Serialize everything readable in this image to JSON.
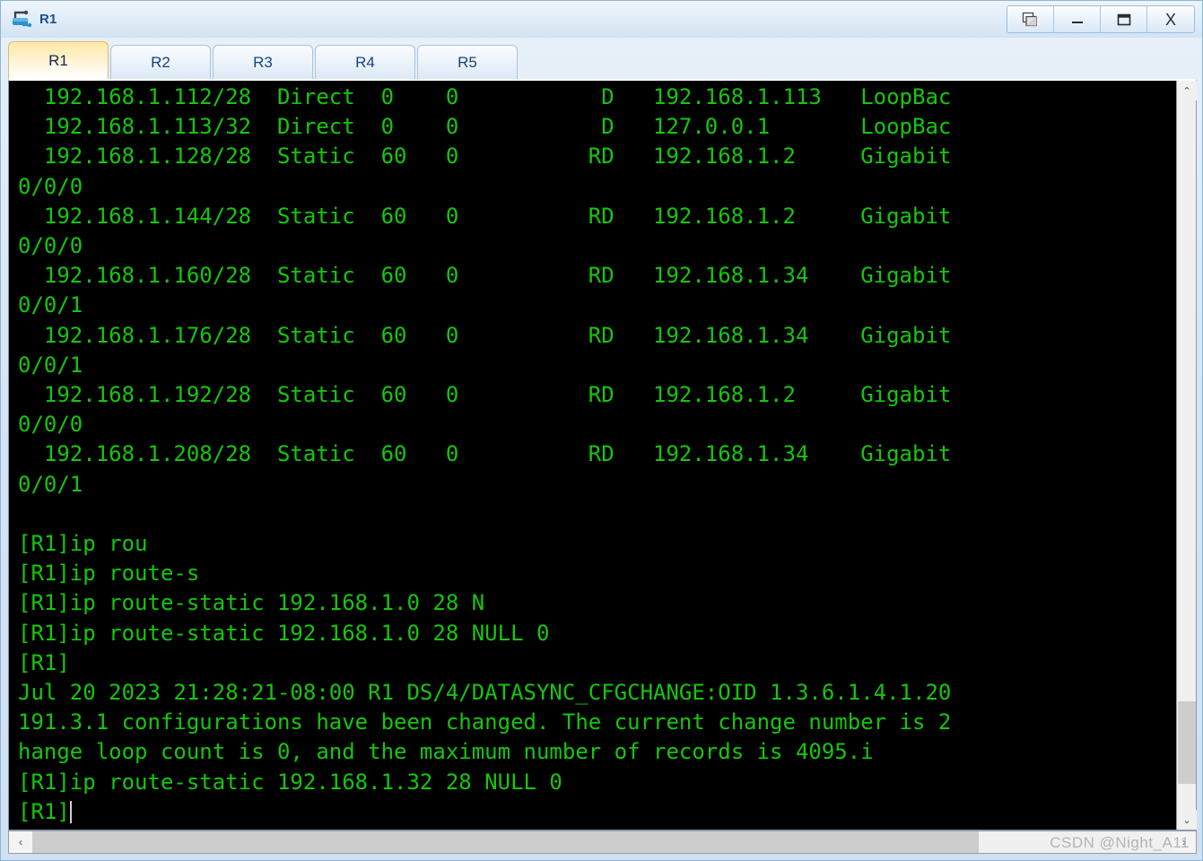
{
  "window": {
    "title": "R1",
    "icon": "router-icon",
    "buttons": [
      {
        "name": "restore-window-button",
        "icon": "cascade-windows-icon",
        "label": ""
      },
      {
        "name": "minimize-window-button",
        "icon": "minimize-icon",
        "label": ""
      },
      {
        "name": "maximize-window-button",
        "icon": "maximize-icon",
        "label": ""
      },
      {
        "name": "close-window-button",
        "icon": "close-icon",
        "label": "X"
      }
    ]
  },
  "tabs": [
    {
      "label": "R1",
      "active": true
    },
    {
      "label": "R2",
      "active": false
    },
    {
      "label": "R3",
      "active": false
    },
    {
      "label": "R4",
      "active": false
    },
    {
      "label": "R5",
      "active": false
    }
  ],
  "terminal": {
    "fg_color": "#16c60c",
    "bg_color": "#000000",
    "prompt": "[R1]",
    "lines": [
      "  192.168.1.112/28  Direct  0    0           D   192.168.1.113   LoopBac",
      "  192.168.1.113/32  Direct  0    0           D   127.0.0.1       LoopBac",
      "  192.168.1.128/28  Static  60   0          RD   192.168.1.2     Gigabit",
      "0/0/0",
      "  192.168.1.144/28  Static  60   0          RD   192.168.1.2     Gigabit",
      "0/0/0",
      "  192.168.1.160/28  Static  60   0          RD   192.168.1.34    Gigabit",
      "0/0/1",
      "  192.168.1.176/28  Static  60   0          RD   192.168.1.34    Gigabit",
      "0/0/1",
      "  192.168.1.192/28  Static  60   0          RD   192.168.1.2     Gigabit",
      "0/0/0",
      "  192.168.1.208/28  Static  60   0          RD   192.168.1.34    Gigabit",
      "0/0/1",
      "",
      "[R1]ip rou",
      "[R1]ip route-s",
      "[R1]ip route-static 192.168.1.0 28 N",
      "[R1]ip route-static 192.168.1.0 28 NULL 0",
      "[R1]",
      "Jul 20 2023 21:28:21-08:00 R1 DS/4/DATASYNC_CFGCHANGE:OID 1.3.6.1.4.1.20",
      "191.3.1 configurations have been changed. The current change number is 2",
      "hange loop count is 0, and the maximum number of records is 4095.i",
      "[R1]ip route-static 192.168.1.32 28 NULL 0"
    ],
    "last_line": "[R1]",
    "cursor_visible": true
  },
  "scrollbars": {
    "vertical": {
      "up_glyph": "⌃",
      "down_glyph": "⌄"
    },
    "horizontal": {
      "left_glyph": "‹",
      "right_glyph": "›"
    }
  },
  "watermark": {
    "text": "CSDN @Night_A11"
  }
}
